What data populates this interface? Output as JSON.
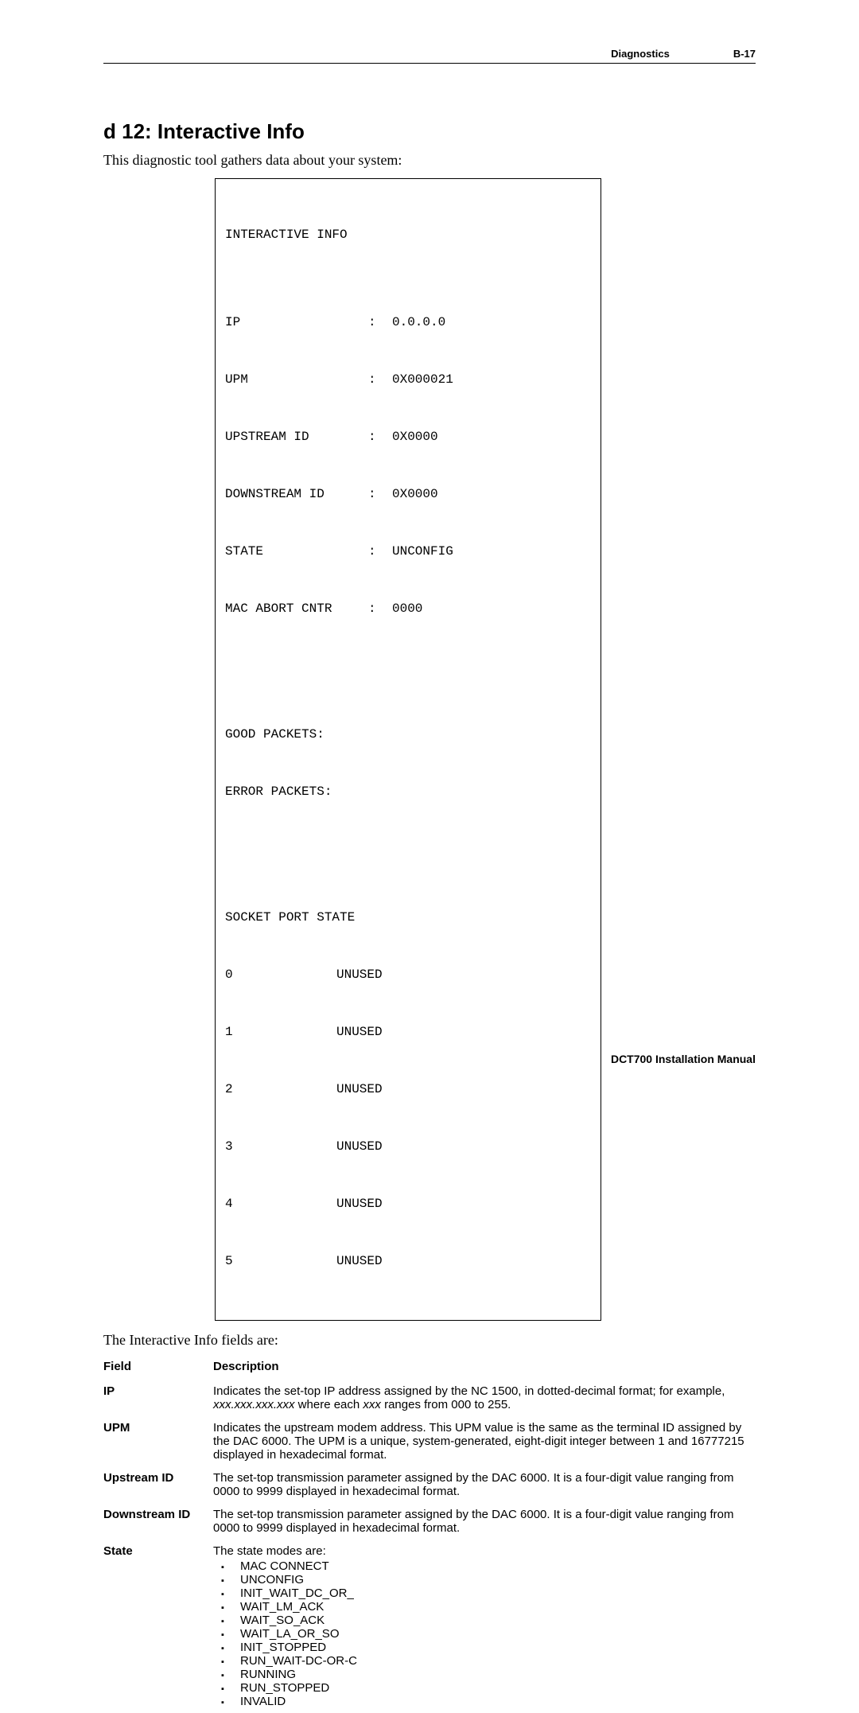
{
  "header": {
    "section": "Diagnostics",
    "pageref": "B-17"
  },
  "title": "d 12: Interactive Info",
  "intro": "This diagnostic tool gathers data about your system:",
  "diag": {
    "heading": "INTERACTIVE INFO",
    "rows": [
      {
        "k": "IP",
        "v": "0.0.0.0"
      },
      {
        "k": "UPM",
        "v": "0X000021"
      },
      {
        "k": "UPSTREAM ID",
        "v": "0X0000"
      },
      {
        "k": "DOWNSTREAM ID",
        "v": "0X0000"
      },
      {
        "k": "STATE",
        "v": "UNCONFIG"
      },
      {
        "k": "MAC ABORT CNTR",
        "v": "0000"
      }
    ],
    "extra": [
      "GOOD PACKETS:",
      "ERROR PACKETS:"
    ],
    "socket_heading": "SOCKET PORT STATE",
    "sockets": [
      {
        "id": "0",
        "state": "UNUSED"
      },
      {
        "id": "1",
        "state": "UNUSED"
      },
      {
        "id": "2",
        "state": "UNUSED"
      },
      {
        "id": "3",
        "state": "UNUSED"
      },
      {
        "id": "4",
        "state": "UNUSED"
      },
      {
        "id": "5",
        "state": "UNUSED"
      }
    ]
  },
  "sub_intro": "The Interactive Info fields are:",
  "table": {
    "h_field": "Field",
    "h_desc": "Description",
    "rows": {
      "ip": {
        "name": "IP",
        "desc_a": "Indicates the set-top IP address assigned by the NC 1500, in dotted-decimal format; for example, ",
        "desc_i1": "xxx.xxx.xxx.xxx",
        "desc_b": " where each ",
        "desc_i2": "xxx",
        "desc_c": " ranges from 000 to 255."
      },
      "upm": {
        "name": "UPM",
        "desc": "Indicates the upstream modem address. This UPM value is the same as the terminal ID assigned by the DAC 6000. The UPM is a unique, system-generated, eight-digit integer between 1 and 16777215 displayed in hexadecimal format."
      },
      "up": {
        "name": "Upstream ID",
        "desc": "The set-top transmission parameter assigned by the DAC 6000. It is a four-digit value ranging from 0000 to 9999 displayed in hexadecimal format."
      },
      "down": {
        "name": "Downstream ID",
        "desc": "The set-top transmission parameter assigned by the DAC 6000. It is a four-digit value ranging from 0000 to 9999 displayed in hexadecimal format."
      },
      "state": {
        "name": "State",
        "desc": "The state modes are:",
        "items": [
          "MAC CONNECT",
          "UNCONFIG",
          "INIT_WAIT_DC_OR_",
          "WAIT_LM_ACK",
          "WAIT_SO_ACK",
          "WAIT_LA_OR_SO",
          "INIT_STOPPED",
          "RUN_WAIT-DC-OR-C",
          "RUNNING",
          "RUN_STOPPED",
          "INVALID"
        ]
      }
    }
  },
  "footer": "DCT700 Installation Manual"
}
